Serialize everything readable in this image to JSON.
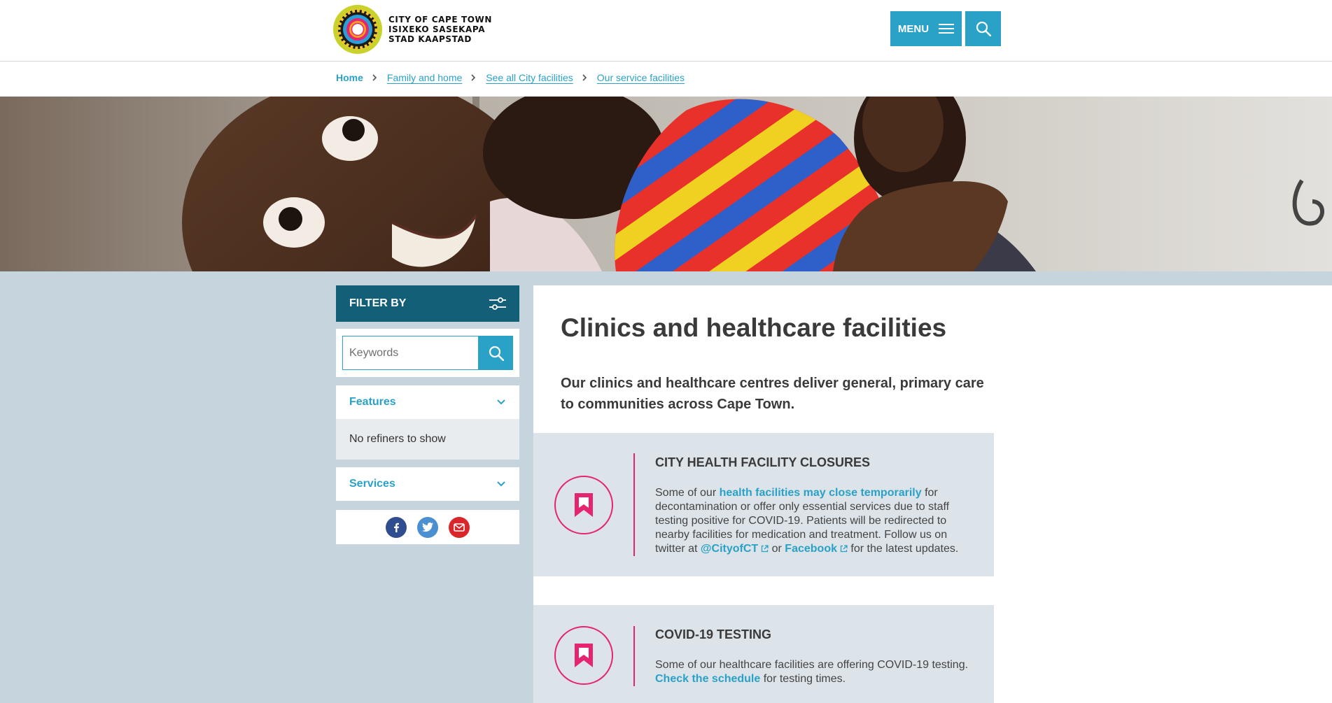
{
  "header": {
    "logo_lines": [
      "CITY OF CAPE TOWN",
      "ISIXEKO SASEKAPA",
      "STAD KAAPSTAD"
    ],
    "menu_label": "MENU",
    "icons": {
      "menu": "hamburger-icon",
      "search": "search-icon"
    }
  },
  "breadcrumb": {
    "items": [
      {
        "label": "Home"
      },
      {
        "label": "Family and home"
      },
      {
        "label": "See all City facilities"
      },
      {
        "label": "Our service facilities"
      }
    ],
    "separator_icon": "chevron-right-icon"
  },
  "hero": {
    "alt": "Mother smiling while holding a child in a striped jacket"
  },
  "sidebar": {
    "filter_label": "FILTER BY",
    "filter_icon": "sliders-icon",
    "keywords_placeholder": "Keywords",
    "features_label": "Features",
    "features_empty": "No refiners to show",
    "services_label": "Services",
    "social": [
      "facebook-icon",
      "twitter-icon",
      "email-icon"
    ]
  },
  "main": {
    "title": "Clinics and healthcare facilities",
    "intro": "Our clinics and healthcare centres deliver general, primary care to communities across Cape Town.",
    "notices": [
      {
        "title": "CITY HEALTH FACILITY CLOSURES",
        "text_1": "Some of our ",
        "link_1": "health facilities may close temporarily",
        "text_2": " for decontamination or offer only essential services due to staff testing positive for COVID-19. Patients will be redirected to nearby facilities for medication and treatment. Follow us on twitter at ",
        "link_2": "@CityofCT",
        "text_3": " or ",
        "link_3": "Facebook",
        "text_4": " for the latest updates."
      },
      {
        "title": "COVID-19 TESTING",
        "text_1": "Some of our healthcare facilities are offering COVID-19 testing. ",
        "link_1": "Check the schedule",
        "text_2": " for testing times."
      }
    ]
  },
  "colors": {
    "accent": "#2aa1c7",
    "filter_header": "#135f78",
    "notice_accent": "#e5256f",
    "content_background": "#c6d4de",
    "notice_background": "#dce3e9"
  }
}
